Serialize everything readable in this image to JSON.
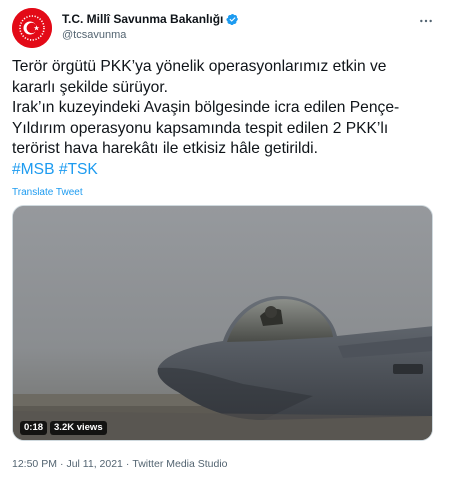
{
  "account": {
    "display_name": "T.C. Millî Savunma Bakanlığı",
    "handle": "@tcsavunma",
    "avatar_icon": "turkish-flag-star-crescent-icon",
    "verified_icon": "verified-badge-icon",
    "more_icon": "more-options-icon"
  },
  "tweet": {
    "lines": [
      "Terör örgütü PKK’ya yönelik operasyonlarımız etkin ve",
      "kararlı şekilde sürüyor.",
      "Irak’ın kuzeyindeki Avaşin bölgesinde icra edilen Pençe-",
      "Yıldırım operasyonu kapsamında tespit edilen 2 PKK’lı",
      "terörist hava harekâtı ile etkisiz hâle getirildi."
    ],
    "hashtags": [
      "#MSB",
      "#TSK"
    ],
    "translate_label": "Translate Tweet"
  },
  "media": {
    "duration": "0:18",
    "views": "3.2K views",
    "description_icon": "fighter-jet-video-thumbnail"
  },
  "meta": {
    "time": "12:50 PM",
    "separator": "·",
    "date": "Jul 11, 2021",
    "source": "Twitter Media Studio"
  },
  "colors": {
    "accent": "#1d9bf0",
    "text": "#0f1419",
    "secondary": "#536471",
    "avatar_red": "#e30a17"
  }
}
